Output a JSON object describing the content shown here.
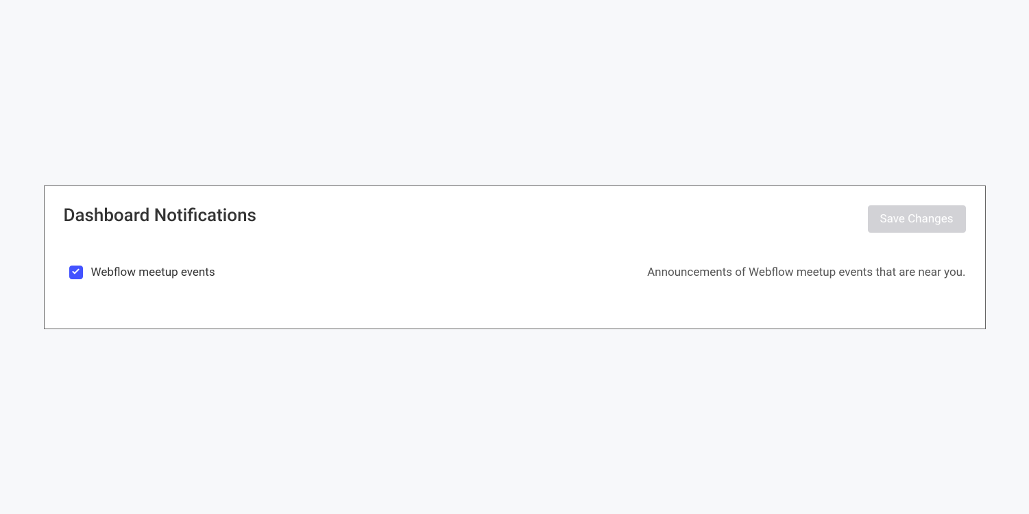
{
  "card": {
    "title": "Dashboard Notifications",
    "save_button_label": "Save Changes"
  },
  "notification": {
    "label": "Webflow meetup events",
    "description": "Announcements of Webflow meetup events that are near you.",
    "checked": true
  }
}
